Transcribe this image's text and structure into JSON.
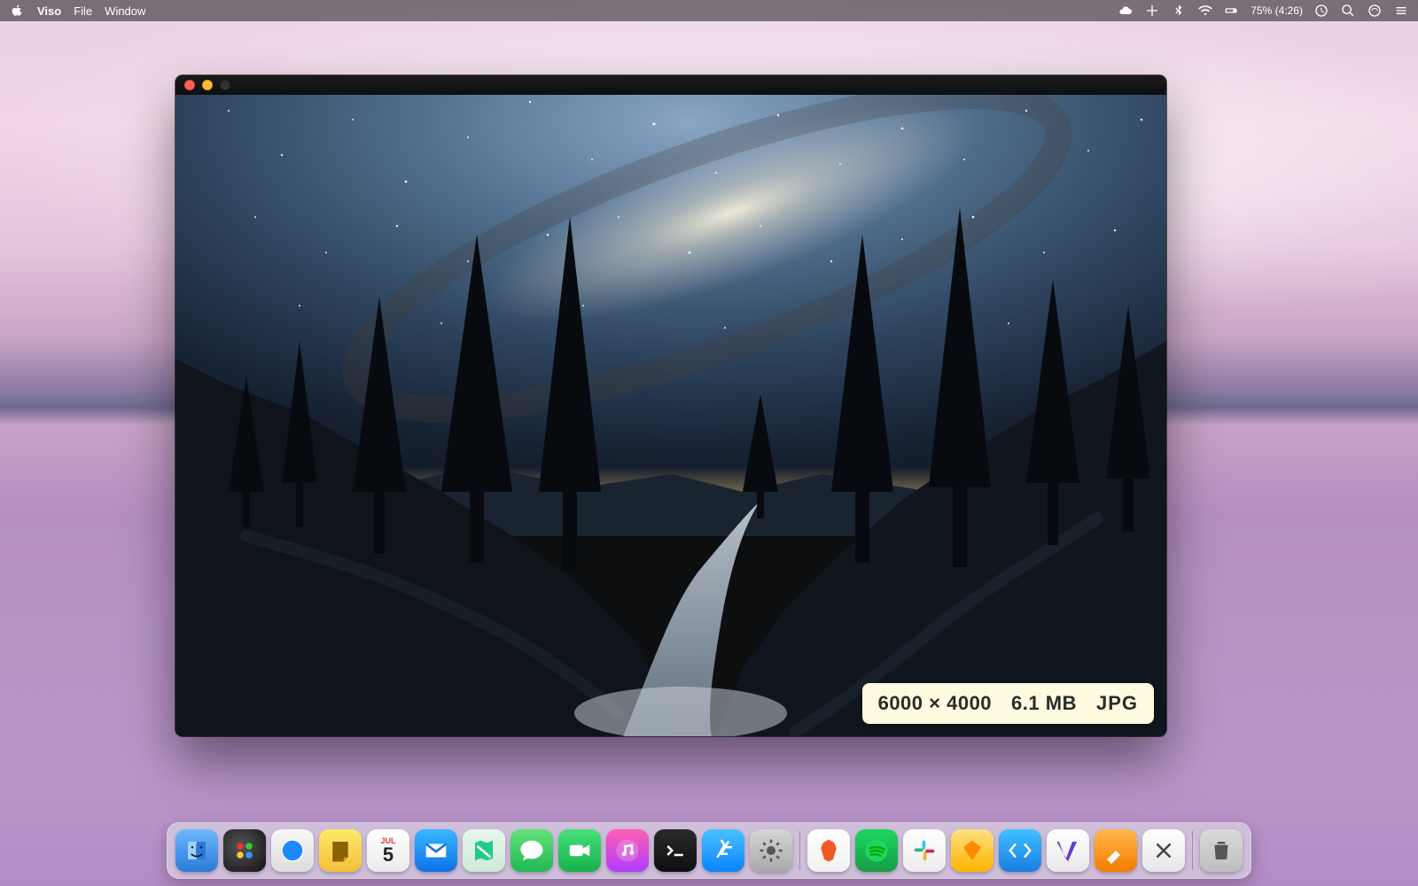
{
  "menubar": {
    "app_name": "Viso",
    "menus": [
      "File",
      "Window"
    ],
    "battery_text": "75% (4:26)"
  },
  "window": {
    "info": {
      "dimensions": "6000 × 4000",
      "filesize": "6.1 MB",
      "format": "JPG"
    }
  },
  "dock": {
    "calendar_month": "JUL",
    "calendar_day": "5"
  }
}
